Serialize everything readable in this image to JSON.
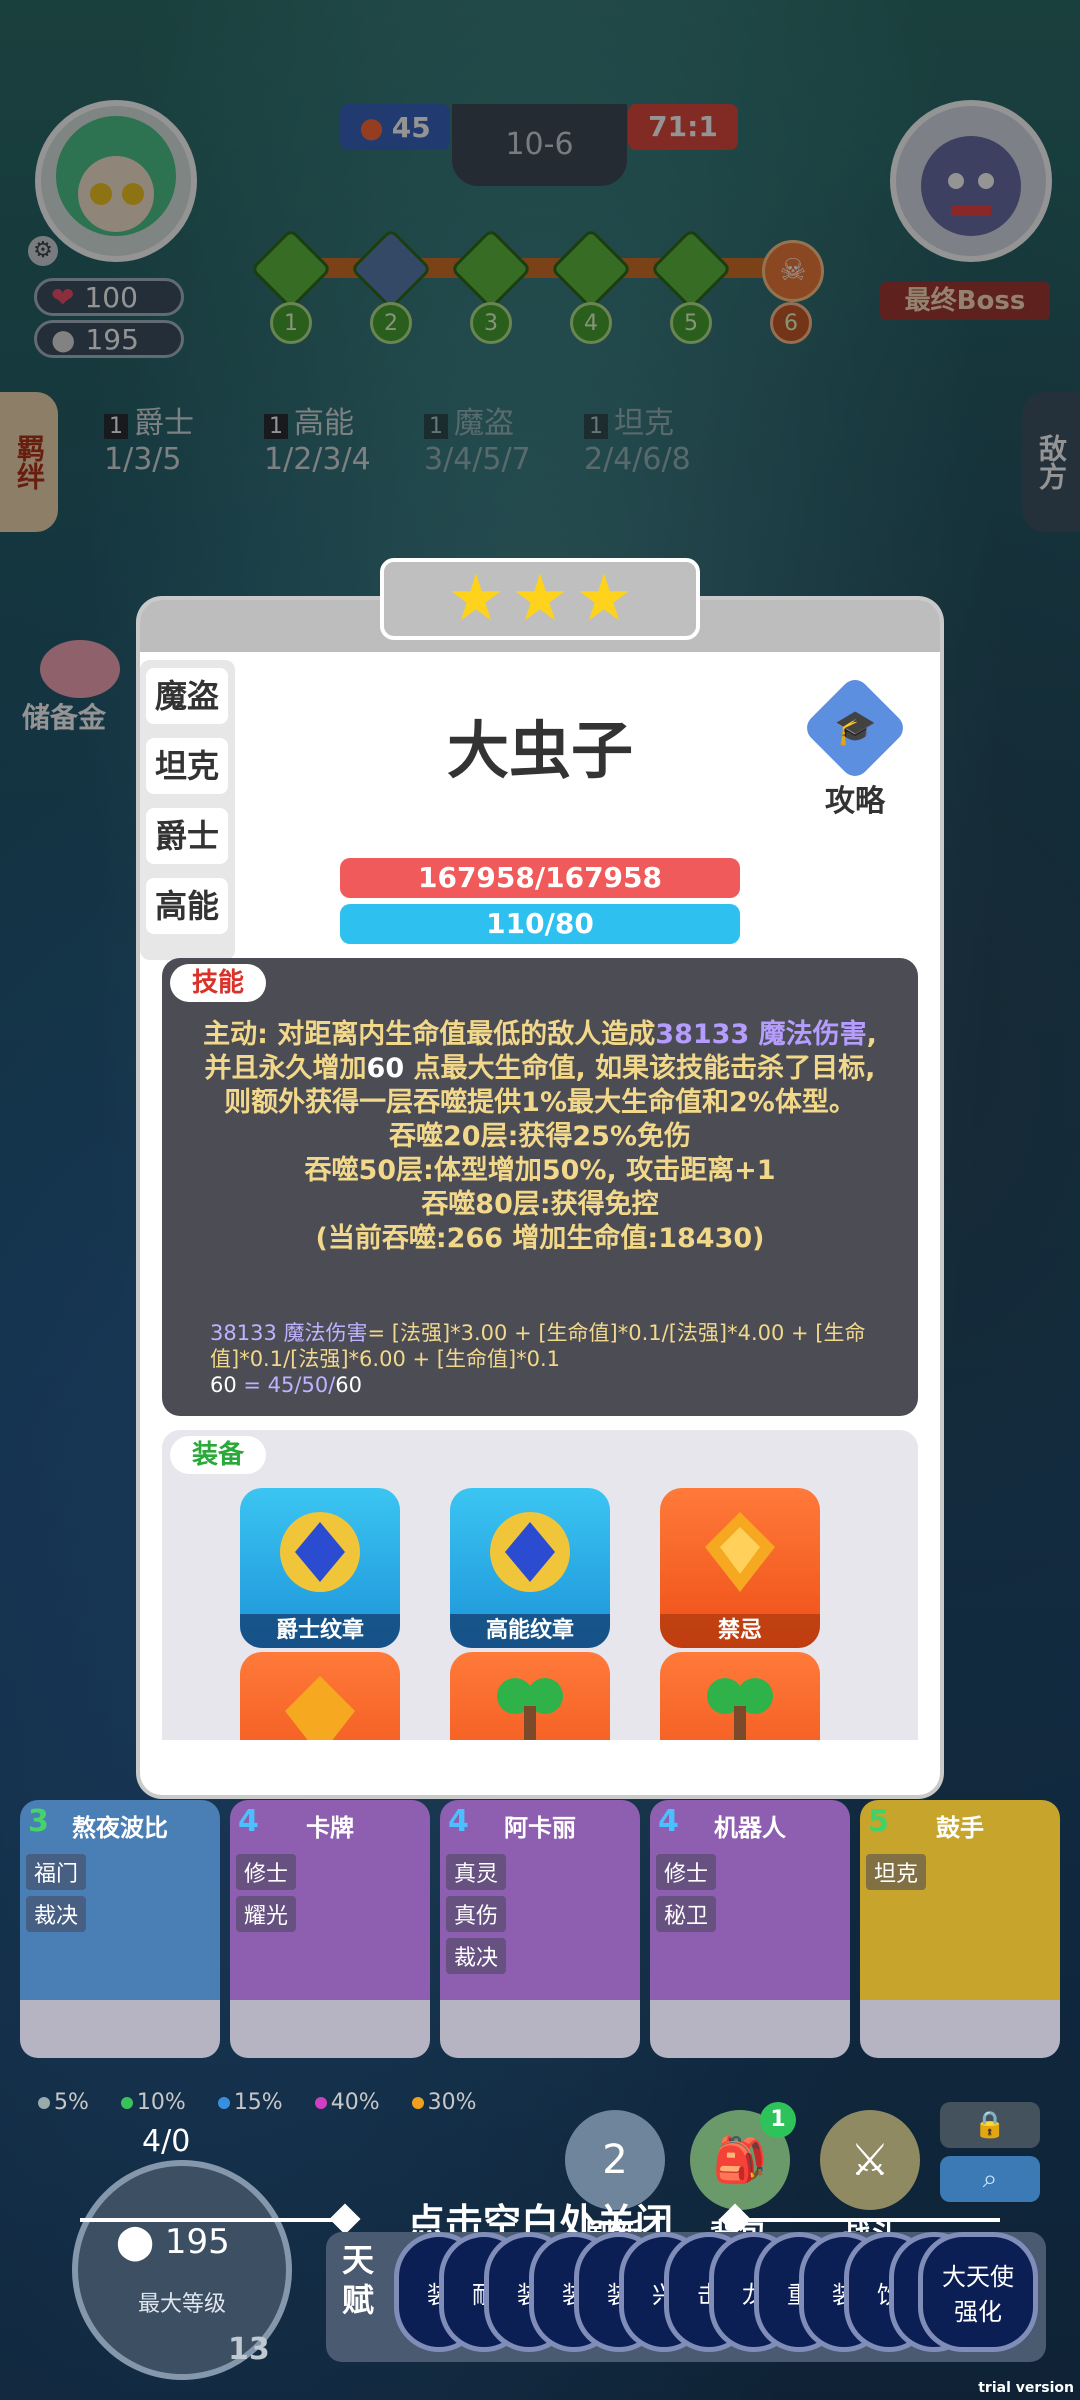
{
  "hud": {
    "round_left": "45",
    "stage": "10-6",
    "round_right": "71:1",
    "hp": "100",
    "gold": "195",
    "boss_label": "最终Boss",
    "stage_nodes": [
      "1",
      "2",
      "3",
      "4",
      "5",
      "6"
    ]
  },
  "side_tabs": {
    "left": "羁绊",
    "right": "敌方"
  },
  "synergies": [
    {
      "count": "1",
      "name": "爵士",
      "levels": "1/3/5"
    },
    {
      "count": "1",
      "name": "高能",
      "levels": "1/2/3/4"
    },
    {
      "count": "1",
      "name": "魔盗",
      "levels": "3/4/5/7"
    },
    {
      "count": "1",
      "name": "坦克",
      "levels": "2/4/6/8"
    }
  ],
  "savings_label": "储备金",
  "modal": {
    "traits": [
      "魔盗",
      "坦克",
      "爵士",
      "高能"
    ],
    "name": "大虫子",
    "guide_label": "攻略",
    "hp_text": "167958/167958",
    "mp_text": "110/80",
    "hp_fill": 1.0,
    "mp_fill": 1.0,
    "skill_tag": "技能",
    "skill": {
      "p1": "主动: 对距离内生命值最低的敌人造成",
      "dmg": "38133 魔法伤害",
      "p2": ", 并且永久增加",
      "hpgain": "60",
      "p3": " 点最大生命值, 如果该技能击杀了目标, 则额外获得一层吞噬提供1%最大生命值和2%体型。",
      "l1": "吞噬20层:获得25%免伤",
      "l2": "吞噬50层:体型增加50%, 攻击距离+1",
      "l3": "吞噬80层:获得免控",
      "l4": "(当前吞噬:266 增加生命值:18430)"
    },
    "formula": {
      "f1": "38133 魔法伤害",
      "f2": "= [法强]*3.00 + [生命值]*0.1/[法强]*4.00 + [生命值]*0.1/[法强]*6.00 + [生命值]*0.1",
      "f3a": "60",
      "f3b": " = 45/50/",
      "f3c": "60"
    },
    "equip_tag": "装备",
    "equipment": [
      {
        "label": "爵士纹章"
      },
      {
        "label": "高能纹章"
      },
      {
        "label": "禁忌"
      },
      {
        "label": ""
      },
      {
        "label": ""
      },
      {
        "label": ""
      }
    ]
  },
  "shop": [
    {
      "cost": "3",
      "name": "熬夜波比",
      "tags": [
        "福门",
        "裁决"
      ]
    },
    {
      "cost": "4",
      "name": "卡牌",
      "tags": [
        "修士",
        "耀光"
      ]
    },
    {
      "cost": "4",
      "name": "阿卡丽",
      "tags": [
        "真灵",
        "真伤",
        "裁决"
      ]
    },
    {
      "cost": "4",
      "name": "机器人",
      "tags": [
        "修士",
        "秘卫"
      ]
    },
    {
      "cost": "5",
      "name": "鼓手",
      "tags": [
        "坦克"
      ]
    }
  ],
  "odds": [
    "5%",
    "10%",
    "15%",
    "40%",
    "30%"
  ],
  "level": {
    "xp": "4/0",
    "gold": "195",
    "label": "最大等级",
    "lvl": "13"
  },
  "buttons": {
    "refresh": "刷新",
    "refresh_cost": "2",
    "bag": "背包",
    "bag_badge": "1",
    "fight": "战斗"
  },
  "close_hint": "点击空白处关闭",
  "talent_label": "天赋",
  "talents": [
    "装",
    "耐",
    "装",
    "装",
    "装",
    "兴",
    "击",
    "龙",
    "重",
    "装",
    "饮",
    "狂"
  ],
  "talent_last": "大天使\n强化",
  "watermark": "trial version",
  "colors": {
    "hp": "#f05a5a",
    "mp": "#2ec0ee",
    "skill_bg": "#4c4c55"
  }
}
